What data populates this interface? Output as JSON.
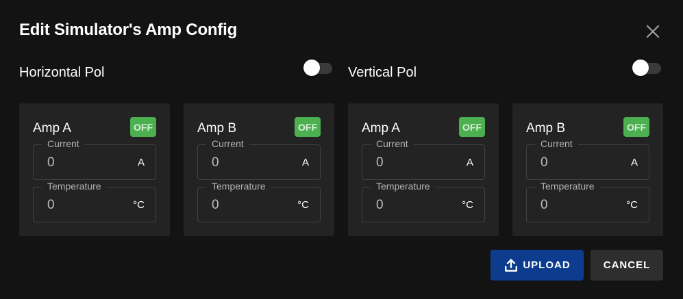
{
  "dialog": {
    "title": "Edit Simulator's Amp Config",
    "close_icon": "close-icon"
  },
  "polarizations": [
    {
      "label": "Horizontal Pol",
      "toggle_on": false
    },
    {
      "label": "Vertical Pol",
      "toggle_on": false
    }
  ],
  "amps": [
    {
      "name": "Amp A",
      "status": "OFF",
      "current": {
        "label": "Current",
        "value": "0",
        "unit": "A"
      },
      "temperature": {
        "label": "Temperature",
        "value": "0",
        "unit": "°C"
      }
    },
    {
      "name": "Amp B",
      "status": "OFF",
      "current": {
        "label": "Current",
        "value": "0",
        "unit": "A"
      },
      "temperature": {
        "label": "Temperature",
        "value": "0",
        "unit": "°C"
      }
    },
    {
      "name": "Amp A",
      "status": "OFF",
      "current": {
        "label": "Current",
        "value": "0",
        "unit": "A"
      },
      "temperature": {
        "label": "Temperature",
        "value": "0",
        "unit": "°C"
      }
    },
    {
      "name": "Amp B",
      "status": "OFF",
      "current": {
        "label": "Current",
        "value": "0",
        "unit": "A"
      },
      "temperature": {
        "label": "Temperature",
        "value": "0",
        "unit": "°C"
      }
    }
  ],
  "actions": {
    "upload_label": "UPLOAD",
    "upload_icon": "upload-icon",
    "cancel_label": "CANCEL"
  },
  "colors": {
    "background": "#131313",
    "card": "#232323",
    "status_off": "#4caf50",
    "primary_button": "#0d3b8e",
    "secondary_button": "#2e2e2e"
  }
}
